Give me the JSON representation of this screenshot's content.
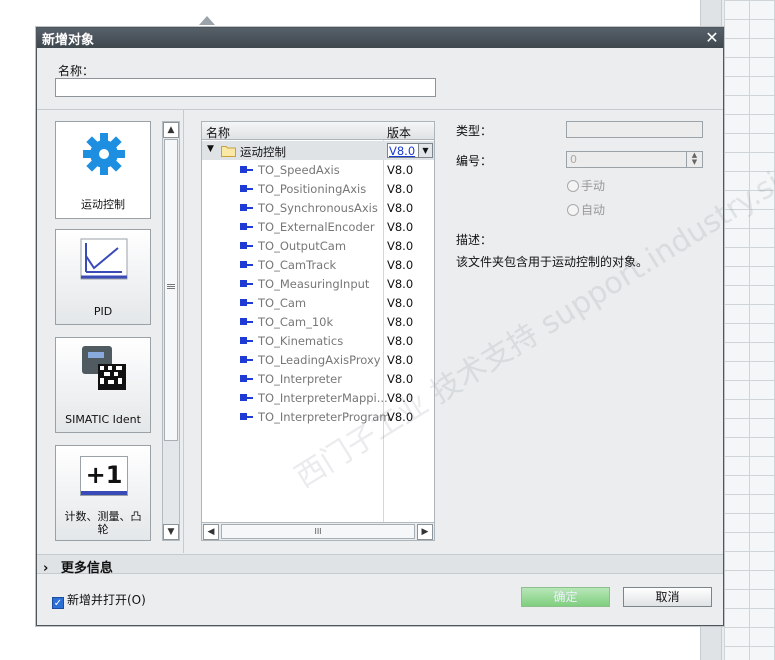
{
  "dialog": {
    "title": "新增对象",
    "close_symbol": "✕",
    "name_label": "名称："
  },
  "categories": [
    {
      "label": "运动控制",
      "icon": "gear-icon",
      "selected": true
    },
    {
      "label": "PID",
      "icon": "pid-chart-icon"
    },
    {
      "label": "SIMATIC Ident",
      "icon": "ident-device-icon"
    },
    {
      "label": "计数、测量、凸轮",
      "icon": "counter-plus1-icon",
      "icon_text": "+1"
    }
  ],
  "tree": {
    "headers": {
      "name": "名称",
      "version": "版本"
    },
    "folder": {
      "label": "运动控制",
      "version": "V8.0",
      "dropdown": "▼",
      "expander": "▼"
    },
    "items": [
      {
        "name": "TO_SpeedAxis",
        "version": "V8.0"
      },
      {
        "name": "TO_PositioningAxis",
        "version": "V8.0"
      },
      {
        "name": "TO_SynchronousAxis",
        "version": "V8.0"
      },
      {
        "name": "TO_ExternalEncoder",
        "version": "V8.0"
      },
      {
        "name": "TO_OutputCam",
        "version": "V8.0"
      },
      {
        "name": "TO_CamTrack",
        "version": "V8.0"
      },
      {
        "name": "TO_MeasuringInput",
        "version": "V8.0"
      },
      {
        "name": "TO_Cam",
        "version": "V8.0"
      },
      {
        "name": "TO_Cam_10k",
        "version": "V8.0"
      },
      {
        "name": "TO_Kinematics",
        "version": "V8.0"
      },
      {
        "name": "TO_LeadingAxisProxy",
        "version": "V8.0"
      },
      {
        "name": "TO_Interpreter",
        "version": "V8.0"
      },
      {
        "name": "TO_InterpreterMappi...",
        "version": "V8.0"
      },
      {
        "name": "TO_InterpreterProgram",
        "version": "V8.0"
      }
    ],
    "hscroll_thumb": "III"
  },
  "info": {
    "type_label": "类型：",
    "number_label": "编号：",
    "number_value": "0",
    "radio_manual": "手动",
    "radio_auto": "自动",
    "desc_label": "描述：",
    "desc_text": "该文件夹包含用于运动控制的对象。"
  },
  "watermark": "西门子工业 技术支持 support.industry.siemens.com/cs",
  "footer": {
    "more_info": "更多信息",
    "more_info_arrow": "›",
    "checkbox_label": "新增并打开(O)",
    "checkbox_checked": true,
    "ok_label": "确定",
    "cancel_label": "取消"
  }
}
